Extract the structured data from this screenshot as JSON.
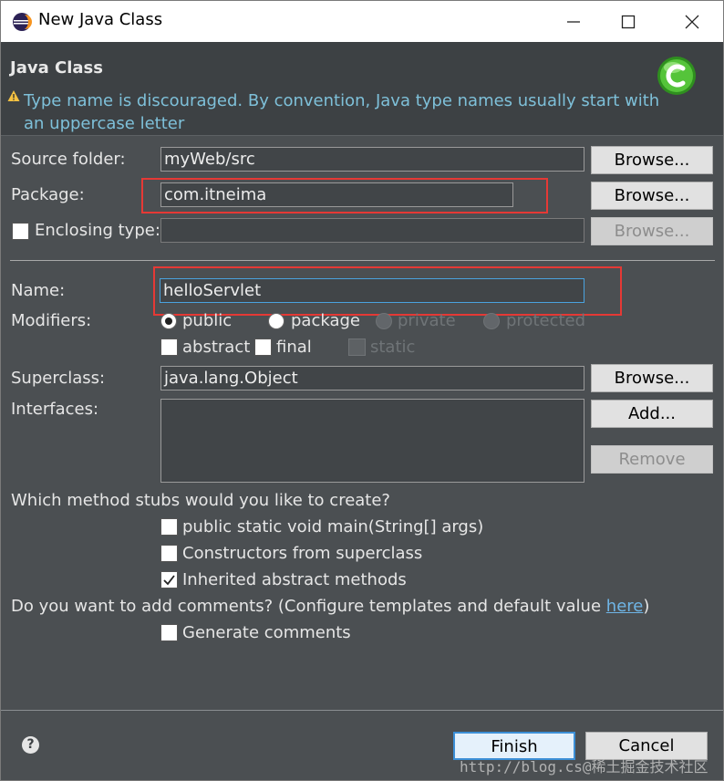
{
  "window": {
    "title": "New Java Class"
  },
  "header": {
    "title": "Java Class",
    "warning": "Type name is discouraged. By convention, Java type names usually start with an uppercase letter"
  },
  "form": {
    "source_folder": {
      "label": "Source folder:",
      "value": "myWeb/src",
      "browse": "Browse..."
    },
    "package": {
      "label": "Package:",
      "value": "com.itneima",
      "browse": "Browse..."
    },
    "enclosing_type": {
      "label": "Enclosing type:",
      "value": "",
      "checked": false,
      "browse": "Browse..."
    },
    "name": {
      "label": "Name:",
      "value": "helloServlet"
    },
    "modifiers": {
      "label": "Modifiers:",
      "public": "public",
      "package": "package",
      "private": "private",
      "protected": "protected",
      "selected": "public",
      "abstract": "abstract",
      "final": "final",
      "static": "static"
    },
    "superclass": {
      "label": "Superclass:",
      "value": "java.lang.Object",
      "browse": "Browse..."
    },
    "interfaces": {
      "label": "Interfaces:",
      "add": "Add...",
      "remove": "Remove"
    },
    "stubs": {
      "question": "Which method stubs would you like to create?",
      "main": "public static void main(String[] args)",
      "main_checked": false,
      "constructors": "Constructors from superclass",
      "constructors_checked": false,
      "inherited": "Inherited abstract methods",
      "inherited_checked": true
    },
    "comments": {
      "question": "Do you want to add comments? (Configure templates and default value",
      "link": "here",
      "close": ")",
      "generate": "Generate comments",
      "generate_checked": false
    }
  },
  "footer": {
    "finish": "Finish",
    "cancel": "Cancel",
    "help": "?"
  },
  "watermark": "http://blog.cs@稀土掘金技术社区",
  "colors": {
    "background": "#4b4f52",
    "header": "#3d4144",
    "accent_link": "#6fb5e6",
    "highlight_box": "#e53935"
  }
}
